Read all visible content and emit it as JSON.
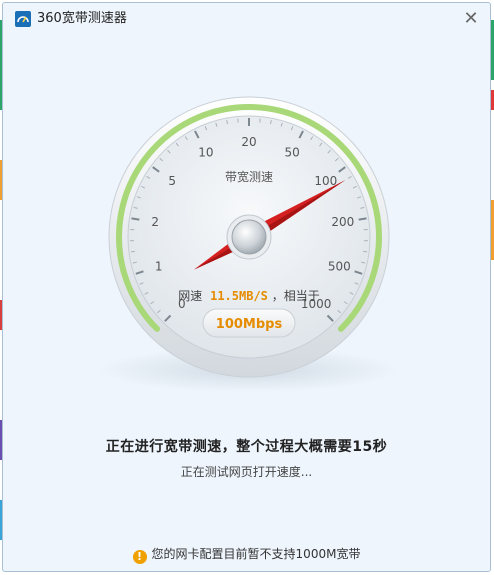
{
  "window": {
    "title": "360宽带测速器",
    "close_symbol": "✕"
  },
  "gauge": {
    "title": "带宽测速",
    "scale_labels": [
      "0",
      "1",
      "2",
      "5",
      "10",
      "20",
      "50",
      "100",
      "200",
      "500",
      "1000"
    ],
    "speed_label": "网速",
    "speed_value": "11.5MB/S",
    "equivalent_label": "，相当于",
    "bandwidth_value": "100Mbps",
    "needle_fraction": 0.72
  },
  "status": {
    "main": "正在进行宽带测速，整个过程大概需要15秒",
    "sub": "正在测试网页打开速度..."
  },
  "notice": {
    "icon": "!",
    "text": "您的网卡配置目前暂不支持1000M宽带"
  },
  "colors": {
    "accent_green": "#a8d878",
    "needle_red": "#d42020",
    "value_orange": "#e58c00"
  },
  "icons": {
    "app": "speedometer-app-icon",
    "close": "close-icon",
    "notice": "warning-icon"
  }
}
